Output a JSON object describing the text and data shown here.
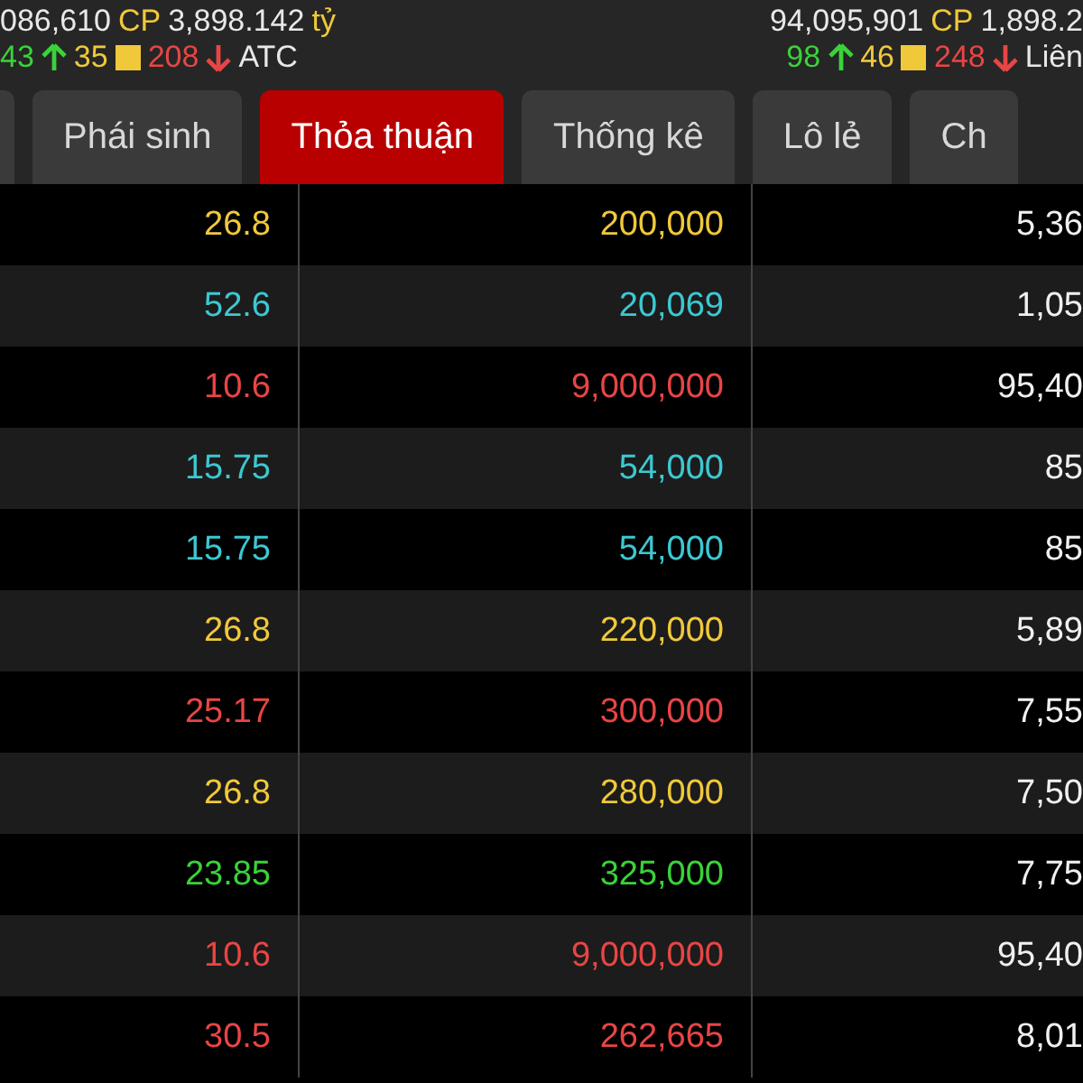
{
  "summary": [
    {
      "volume": "086,610",
      "volume_unit": "CP",
      "value": "3,898.142",
      "value_unit": "tỷ",
      "up": "43",
      "ref": "35",
      "down": "208",
      "session": "ATC"
    },
    {
      "volume": "94,095,901",
      "volume_unit": "CP",
      "value": "1,898.2",
      "up": "98",
      "ref": "46",
      "down": "248",
      "session": "Liên"
    }
  ],
  "tabs": [
    {
      "label": "Phái sinh",
      "selected": false
    },
    {
      "label": "Thỏa thuận",
      "selected": true
    },
    {
      "label": "Thống kê",
      "selected": false
    },
    {
      "label": "Lô lẻ",
      "selected": false
    },
    {
      "label": "Ch",
      "selected": false
    }
  ],
  "rows": [
    {
      "price": "26.8",
      "volume": "200,000",
      "value": "5,36",
      "color": "#f0c93a"
    },
    {
      "price": "52.6",
      "volume": "20,069",
      "value": "1,05",
      "color": "#3cc8d2"
    },
    {
      "price": "10.6",
      "volume": "9,000,000",
      "value": "95,40",
      "color": "#e84545"
    },
    {
      "price": "15.75",
      "volume": "54,000",
      "value": "85",
      "color": "#3cc8d2"
    },
    {
      "price": "15.75",
      "volume": "54,000",
      "value": "85",
      "color": "#3cc8d2"
    },
    {
      "price": "26.8",
      "volume": "220,000",
      "value": "5,89",
      "color": "#f0c93a"
    },
    {
      "price": "25.17",
      "volume": "300,000",
      "value": "7,55",
      "color": "#e84545"
    },
    {
      "price": "26.8",
      "volume": "280,000",
      "value": "7,50",
      "color": "#f0c93a"
    },
    {
      "price": "23.85",
      "volume": "325,000",
      "value": "7,75",
      "color": "#3ad23a"
    },
    {
      "price": "10.6",
      "volume": "9,000,000",
      "value": "95,40",
      "color": "#e84545"
    },
    {
      "price": "30.5",
      "volume": "262,665",
      "value": "8,01",
      "color": "#e84545"
    }
  ]
}
